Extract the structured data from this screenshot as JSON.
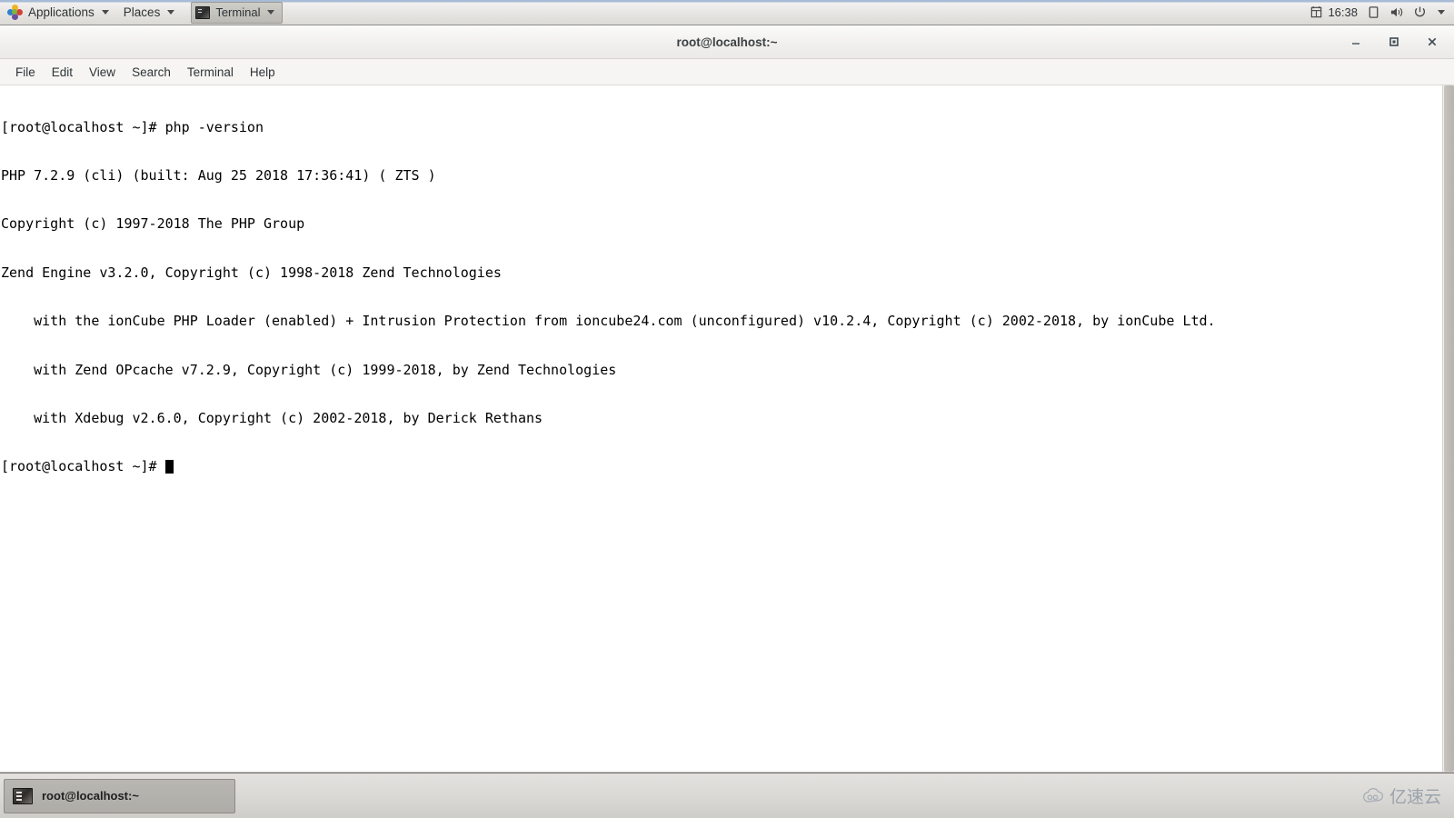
{
  "top_panel": {
    "applications": {
      "label": "Applications",
      "icon": "applications-pinwheel-icon"
    },
    "places": {
      "label": "Places",
      "icon": "chevron-down-icon"
    },
    "window_task": {
      "label": "Terminal",
      "icon": "terminal-icon"
    },
    "tray": {
      "calendar_icon": "calendar-icon",
      "clock": "16:38",
      "display_icon": "display-icon",
      "volume_icon": "speaker-icon",
      "power_icon": "power-icon",
      "menu_icon": "chevron-down-icon"
    }
  },
  "window": {
    "title": "root@localhost:~",
    "controls": {
      "minimize": "minimize-icon",
      "maximize": "maximize-icon",
      "close": "close-icon"
    },
    "menubar": [
      {
        "label": "File"
      },
      {
        "label": "Edit"
      },
      {
        "label": "View"
      },
      {
        "label": "Search"
      },
      {
        "label": "Terminal"
      },
      {
        "label": "Help"
      }
    ]
  },
  "terminal": {
    "background": "#ffffff",
    "foreground": "#000000",
    "lines": [
      "[root@localhost ~]# php -version",
      "PHP 7.2.9 (cli) (built: Aug 25 2018 17:36:41) ( ZTS )",
      "Copyright (c) 1997-2018 The PHP Group",
      "Zend Engine v3.2.0, Copyright (c) 1998-2018 Zend Technologies",
      "    with the ionCube PHP Loader (enabled) + Intrusion Protection from ioncube24.com (unconfigured) v10.2.4, Copyright (c) 2002-2018, by ionCube Ltd.",
      "    with Zend OPcache v7.2.9, Copyright (c) 1999-2018, by Zend Technologies",
      "    with Xdebug v2.6.0, Copyright (c) 2002-2018, by Derick Rethans"
    ],
    "prompt": "[root@localhost ~]# ",
    "cursor": "block-cursor"
  },
  "bottom_panel": {
    "taskbar_item": {
      "label": "root@localhost:~",
      "icon": "terminal-icon"
    },
    "watermark": {
      "text": "亿速云",
      "icon": "cloud-logo-icon"
    }
  }
}
